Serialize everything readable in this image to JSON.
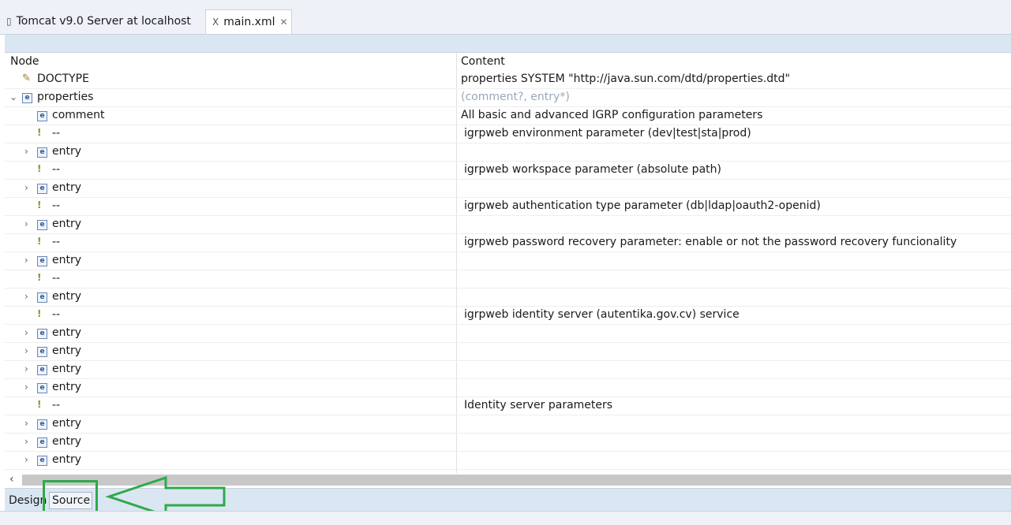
{
  "tabs": [
    {
      "label": "Tomcat v9.0 Server at localhost",
      "icon": "server-icon",
      "active": false
    },
    {
      "label": "main.xml",
      "icon": "xml-file-icon",
      "active": true,
      "close_glyph": "✕"
    }
  ],
  "tree": {
    "headers": {
      "node": "Node",
      "content": "Content"
    },
    "rows": [
      {
        "node": "DOCTYPE",
        "icon": "doctype-icon",
        "content": "properties SYSTEM \"http://java.sun.com/dtd/properties.dtd\""
      },
      {
        "node": "properties",
        "icon": "element-icon",
        "content": "(comment?, entry*)",
        "expanded": true
      },
      {
        "node": "comment",
        "icon": "element-icon",
        "content": "All basic and advanced IGRP configuration parameters"
      },
      {
        "node": "--",
        "icon": "comment-icon",
        "content": "igrpweb environment parameter (dev|test|sta|prod)"
      },
      {
        "node": "entry",
        "icon": "element-icon",
        "content": ""
      },
      {
        "node": "--",
        "icon": "comment-icon",
        "content": "igrpweb workspace parameter (absolute path)"
      },
      {
        "node": "entry",
        "icon": "element-icon",
        "content": ""
      },
      {
        "node": "--",
        "icon": "comment-icon",
        "content": "igrpweb authentication type parameter (db|ldap|oauth2-openid)"
      },
      {
        "node": "entry",
        "icon": "element-icon",
        "content": ""
      },
      {
        "node": "--",
        "icon": "comment-icon",
        "content": "igrpweb password recovery parameter: enable or not the password recovery funcionality"
      },
      {
        "node": "entry",
        "icon": "element-icon",
        "content": ""
      },
      {
        "node": "--",
        "icon": "comment-icon",
        "content": ""
      },
      {
        "node": "entry",
        "icon": "element-icon",
        "content": ""
      },
      {
        "node": "--",
        "icon": "comment-icon",
        "content": "igrpweb identity server (autentika.gov.cv) service"
      },
      {
        "node": "entry",
        "icon": "element-icon",
        "content": ""
      },
      {
        "node": "entry",
        "icon": "element-icon",
        "content": ""
      },
      {
        "node": "entry",
        "icon": "element-icon",
        "content": ""
      },
      {
        "node": "entry",
        "icon": "element-icon",
        "content": ""
      },
      {
        "node": "--",
        "icon": "comment-icon",
        "content": "Identity server parameters"
      },
      {
        "node": "entry",
        "icon": "element-icon",
        "content": ""
      },
      {
        "node": "entry",
        "icon": "element-icon",
        "content": ""
      },
      {
        "node": "entry",
        "icon": "element-icon",
        "content": ""
      }
    ]
  },
  "bottom_tabs": {
    "design": "Design",
    "source": "Source"
  },
  "colors": {
    "highlight": "#2eaa4a",
    "bar": "#dbe6f3"
  }
}
